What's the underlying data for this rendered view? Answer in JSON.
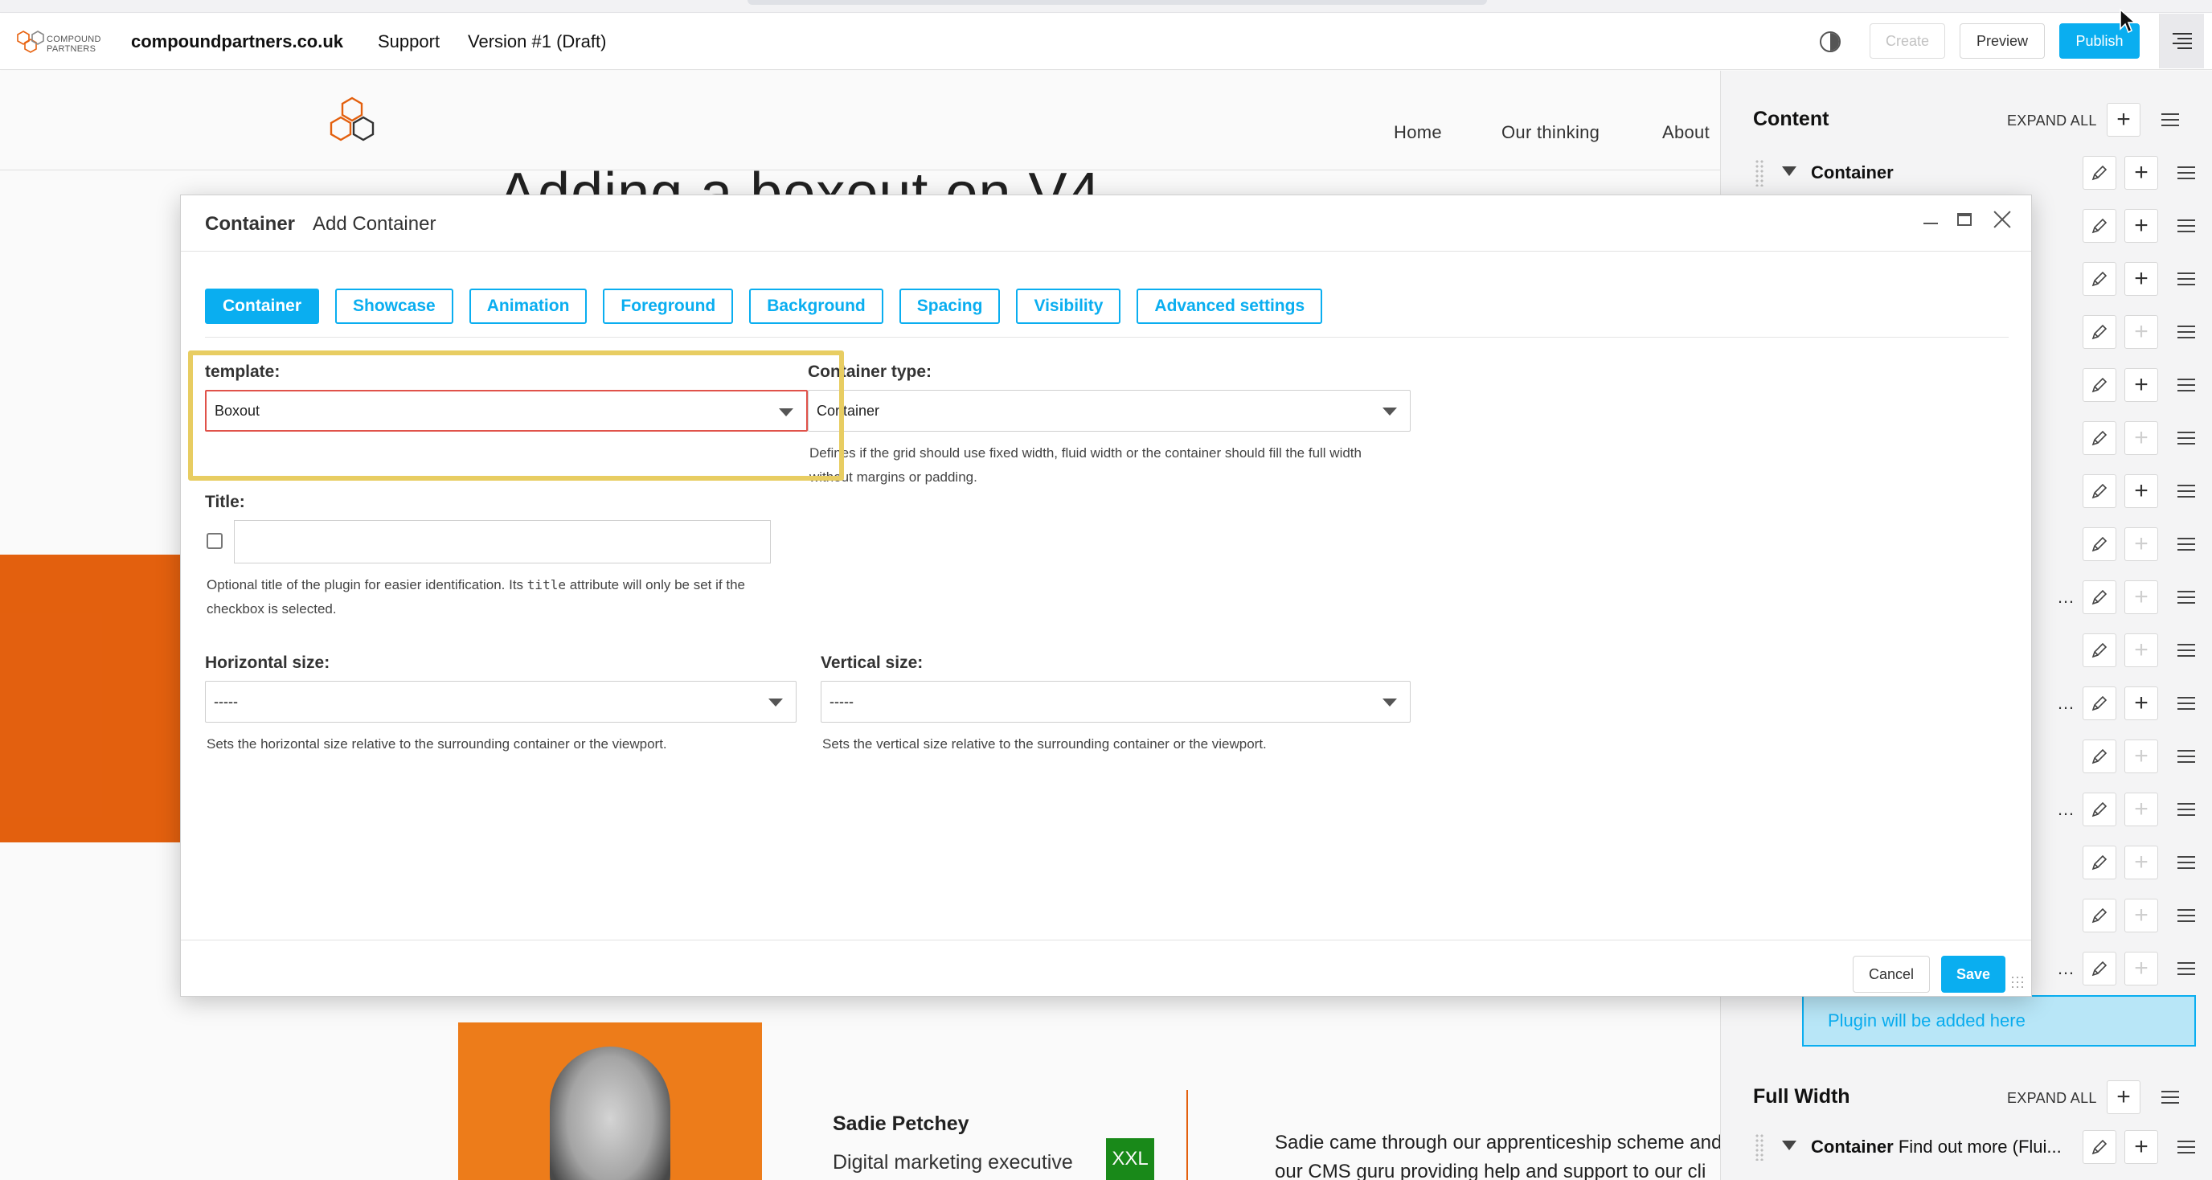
{
  "toolbar": {
    "logo_text": "COMPOUND\nPARTNERS",
    "site": "compoundpartners.co.uk",
    "support": "Support",
    "version": "Version #1 (Draft)",
    "create": "Create",
    "preview": "Preview",
    "publish": "Publish",
    "accent": "#0aaef0"
  },
  "page": {
    "nav": [
      "Home",
      "Our thinking",
      "About"
    ],
    "heading": "Adding a boxout on V4",
    "person_name": "Sadie Petchey",
    "person_role": "Digital marketing executive",
    "badge": "XXL",
    "bio_1": "Sadie came through our apprenticeship scheme and",
    "bio_2": "our CMS guru providing help and support to our cli",
    "brand_orange": "#e8620f"
  },
  "modal": {
    "title": "Container",
    "subtitle": "Add Container",
    "tabs": [
      "Container",
      "Showcase",
      "Animation",
      "Foreground",
      "Background",
      "Spacing",
      "Visibility",
      "Advanced settings"
    ],
    "template_label": "template:",
    "template_value": "Boxout",
    "container_type_label": "Container type:",
    "container_type_value": "Container",
    "container_type_help": "Defines if the grid should use fixed width, fluid width or the container should fill the full width without margins or padding.",
    "title_label": "Title:",
    "title_value": "",
    "title_help_before": "Optional title of the plugin for easier identification. Its",
    "title_help_code": "title",
    "title_help_after": "attribute will only be set if the checkbox is selected.",
    "horizontal_label": "Horizontal size:",
    "horizontal_value": "-----",
    "horizontal_help": "Sets the horizontal size relative to the surrounding container or the viewport.",
    "vertical_label": "Vertical size:",
    "vertical_value": "-----",
    "vertical_help": "Sets the vertical size relative to the surrounding container or the viewport.",
    "cancel": "Cancel",
    "save": "Save"
  },
  "panel": {
    "content_header": "Content",
    "expand_all": "EXPAND ALL",
    "first_row_label": "Container",
    "plugin_placeholder": "Plugin will be added here",
    "full_width_header": "Full Width",
    "full_width_row_bold": "Container",
    "full_width_row_rest": "Find out more (Flui..."
  }
}
